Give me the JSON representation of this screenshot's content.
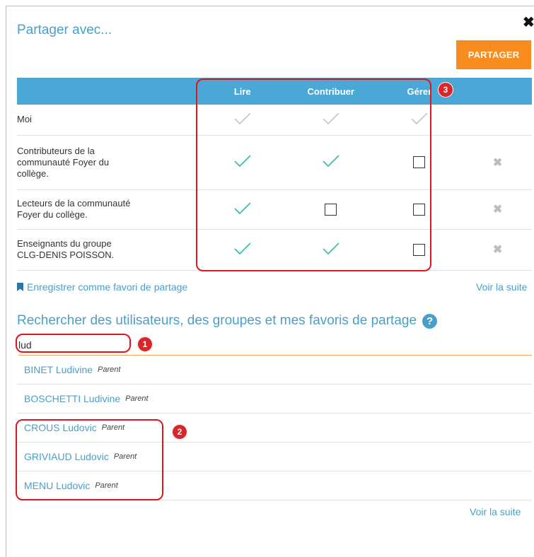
{
  "dialog": {
    "title": "Partager avec...",
    "close_symbol": "✖",
    "share_label": "PARTAGER"
  },
  "table": {
    "headers": [
      "",
      "Lire",
      "Contribuer",
      "Gérer",
      ""
    ],
    "rows": [
      {
        "name": "Moi",
        "lire": "check-disabled",
        "contribuer": "check-disabled",
        "gerer": "check-disabled",
        "removable": false
      },
      {
        "name": "Contributeurs de la communauté Foyer du collège.",
        "lire": "check",
        "contribuer": "check",
        "gerer": "unchecked",
        "removable": true
      },
      {
        "name": "Lecteurs de la communauté Foyer du collège.",
        "lire": "check",
        "contribuer": "unchecked",
        "gerer": "unchecked",
        "removable": true
      },
      {
        "name": "Enseignants du groupe CLG-DENIS POISSON.",
        "lire": "check",
        "contribuer": "check",
        "gerer": "unchecked",
        "removable": true
      }
    ],
    "remove_symbol": "✖"
  },
  "favorites": {
    "save_label": "Enregistrer comme favori de partage",
    "more_label": "Voir la suite"
  },
  "search": {
    "title": "Rechercher des utilisateurs, des groupes et mes favoris de partage",
    "help_symbol": "?",
    "value": "lud",
    "results": [
      {
        "name": "BINET Ludivine",
        "role": "Parent"
      },
      {
        "name": "BOSCHETTI Ludivine",
        "role": "Parent"
      },
      {
        "name": "CROUS Ludovic",
        "role": "Parent"
      },
      {
        "name": "GRIVIAUD Ludovic",
        "role": "Parent"
      },
      {
        "name": "MENU Ludovic",
        "role": "Parent"
      }
    ],
    "more_label": "Voir la suite"
  },
  "annotations": [
    {
      "label": "1"
    },
    {
      "label": "2"
    },
    {
      "label": "3"
    }
  ],
  "colors": {
    "accent": "#4a9fc9",
    "header_bg": "#4aa7d6",
    "button": "#f98c1f",
    "check": "#3cbfae",
    "check_disabled": "#c8c8c8",
    "annotation": "#e0141d"
  },
  "icons": {
    "close": "close-icon",
    "check": "checkmark-icon",
    "checkbox": "empty-checkbox-icon",
    "remove": "remove-x-icon",
    "bookmark": "bookmark-icon",
    "help": "help-circle-icon"
  }
}
